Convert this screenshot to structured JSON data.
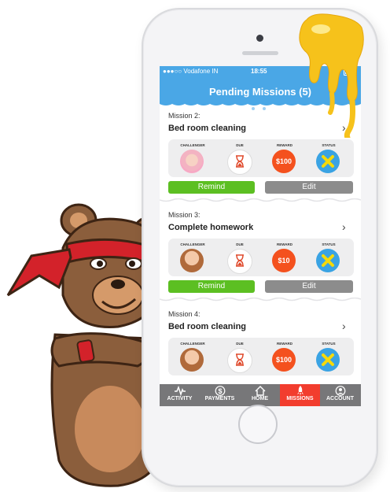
{
  "status_bar": {
    "carrier": "●●●○○ Vodafone IN",
    "time": "18:55"
  },
  "header": {
    "title": "Pending Missions (5)"
  },
  "columns": {
    "challenger": "CHALLENGER",
    "due": "DUE",
    "reward": "REWARD",
    "status": "STATUS"
  },
  "missions": [
    {
      "number": "Mission 2:",
      "name": "Bed room cleaning",
      "reward": "$100",
      "remind": "Remind",
      "edit": "Edit"
    },
    {
      "number": "Mission 3:",
      "name": "Complete homework",
      "reward": "$10",
      "remind": "Remind",
      "edit": "Edit"
    },
    {
      "number": "Mission 4:",
      "name": "Bed room cleaning",
      "reward": "$100"
    }
  ],
  "tabs": [
    {
      "label": "ACTIVITY",
      "icon": "activity-icon"
    },
    {
      "label": "PAYMENTS",
      "icon": "dollar-icon"
    },
    {
      "label": "HOME",
      "icon": "home-icon"
    },
    {
      "label": "MISSIONS",
      "icon": "rocket-icon"
    },
    {
      "label": "ACCOUNT",
      "icon": "account-icon"
    }
  ],
  "colors": {
    "header_blue": "#4aa7e6",
    "remind_green": "#5cbf22",
    "edit_gray": "#8c8c8c",
    "reward_orange": "#f4511e",
    "active_tab_red": "#f23d2e",
    "tabbar_gray": "#777779"
  }
}
